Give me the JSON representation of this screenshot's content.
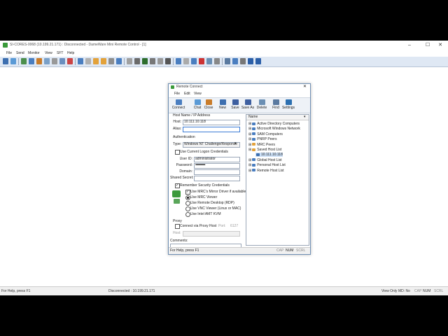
{
  "window": {
    "title": "SI-CORES-0068 (10.199.21.171) : Disconnected - DameWare Mini Remote Control - [1]",
    "min_icon": "–",
    "max_icon": "☐",
    "close_icon": "✕"
  },
  "menu": [
    "File",
    "Send",
    "Monitor",
    "View",
    "SFT",
    "Help"
  ],
  "toolbar_icon_colors": [
    "#3d6fb0",
    "#5a9ad6",
    "#4c8f4c",
    "#4a7ec0",
    "#c97c2a",
    "#7aa0c8",
    "#999",
    "#6b8fbf",
    "#c44",
    "#4a7ec0",
    "#b0b0b0",
    "#e3a23b",
    "#e3a23b",
    "#8e8e8e",
    "#4a7ec0",
    "#a0a0a0",
    "#6a6a6a",
    "#2d6d2d",
    "#777",
    "#999",
    "#555",
    "#4a7ec0",
    "#aaa",
    "#4a7ec0",
    "#c33",
    "#6a8fb4",
    "#888",
    "#5a7aa0",
    "#4a7ec0",
    "#777",
    "#2b5fa8",
    "#2b5fa8"
  ],
  "statusbar": {
    "left": "For Help, press F1",
    "center": "Disconnected : 10.199.21.171",
    "view_only": "View Only",
    "md": "MD: No",
    "cap": "CAP",
    "num": "NUM",
    "scrl": "SCRL"
  },
  "dialog": {
    "title": "Remote Connect",
    "close_icon": "✕",
    "menu": [
      "File",
      "Edit",
      "View"
    ],
    "toolbar": [
      {
        "label": "Connect",
        "icon": "connect-icon",
        "color": "#4a7ec0"
      },
      {
        "label": "Chat",
        "icon": "chat-icon",
        "color": "#5a9ad6"
      },
      {
        "label": "Close",
        "icon": "close-connection-icon",
        "color": "#c97c2a"
      },
      {
        "label": "New",
        "icon": "new-icon",
        "color": "#3d6fb0"
      },
      {
        "label": "Save",
        "icon": "save-icon",
        "color": "#3d5fa0"
      },
      {
        "label": "Save As",
        "icon": "save-as-icon",
        "color": "#3d5fa0"
      },
      {
        "label": "Delete",
        "icon": "delete-icon",
        "color": "#6a8fb4"
      },
      {
        "label": "Find",
        "icon": "find-icon",
        "color": "#5a7aa0"
      },
      {
        "label": "Settings",
        "icon": "settings-icon",
        "color": "#2b6fb0"
      }
    ],
    "host_group": "Host Name / IP Address",
    "host_label": "Host:",
    "host_value": "10.111.10.118",
    "alias_label": "Alias:",
    "alias_value": "",
    "auth_group": "Authentication",
    "type_label": "Type:",
    "type_value": "Windows NT Challenge/Response",
    "use_current_logon": "Use Current Logon Credentials",
    "userid_label": "User ID:",
    "userid_value": "administrator",
    "password_label": "Password:",
    "password_value": "••••••••••••••••••",
    "domain_label": "Domain:",
    "domain_value": "",
    "shared_secret_label": "Shared Secret:",
    "shared_secret_value": "",
    "remember_credentials": "Remember Security Credentials",
    "options": [
      "Use MRC's Mirror Driver if available",
      "Use MRC Viewer",
      "Use Remote Desktop (RDP)",
      "Use VNC Viewer (Linux or MAC)",
      "Use Intel AMT KVM"
    ],
    "proxy_group": "Proxy",
    "proxy_connect": "Connect via Proxy Host",
    "proxy_port_label": "Port:",
    "proxy_port_value": "6127",
    "proxy_host_label": "Host:",
    "comments_label": "Comments:",
    "comments_value": "",
    "status_left": "For Help, press F1",
    "status_cap": "CAP",
    "status_num": "NUM",
    "status_scrl": "SCRL",
    "tree_header": "Name",
    "tree": [
      {
        "label": "Active Directory Computers",
        "indent": 0,
        "color": "#4a7ec0"
      },
      {
        "label": "Microsoft Windows Network",
        "indent": 0,
        "color": "#4a7ec0"
      },
      {
        "label": "SAM Computers",
        "indent": 0,
        "color": "#4a7ec0"
      },
      {
        "label": "PNRP Peers",
        "indent": 0,
        "color": "#4a7ec0"
      },
      {
        "label": "MRC Peers",
        "indent": 0,
        "color": "#e3a23b"
      },
      {
        "label": "Saved Host List",
        "indent": 0,
        "color": "#e3a23b"
      },
      {
        "label": "10.111.10.118",
        "indent": 1,
        "color": "#3d6fb0"
      },
      {
        "label": "Global Host List",
        "indent": 0,
        "color": "#4a7ec0"
      },
      {
        "label": "Personal Host List",
        "indent": 0,
        "color": "#4a7ec0"
      },
      {
        "label": "Remote Host List",
        "indent": 0,
        "color": "#4a7ec0"
      }
    ]
  }
}
